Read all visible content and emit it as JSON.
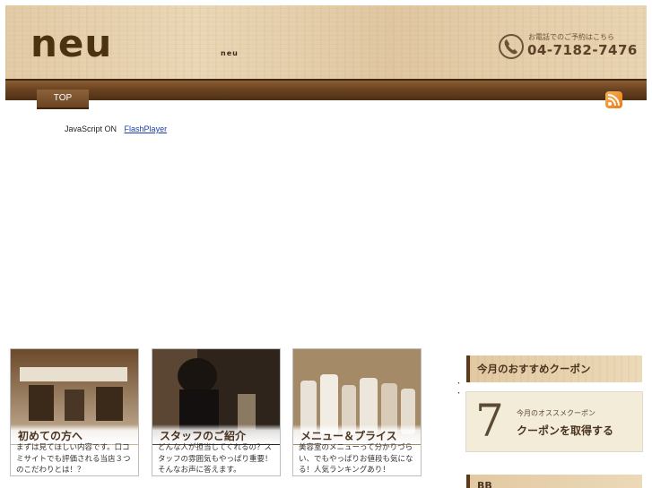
{
  "header": {
    "logo": "neu",
    "site_sub": "neu",
    "phone_note": "お電話でのご予約はこちら",
    "phone_number": "04-7182-7476",
    "phone_icon": "phone-icon"
  },
  "nav": {
    "top_label": "TOP",
    "rss_icon": "rss-icon"
  },
  "flash": {
    "notice": "JavaScript ON",
    "link": "FlashPlayer"
  },
  "cards": [
    {
      "title": "初めての方へ",
      "text": "まずは見てほしい内容です。口コミサイトでも評価される当店３つのこだわりとは！？"
    },
    {
      "title": "スタッフのご紹介",
      "text": "どんな人が担当してくれるの？スタッフの雰囲気もやっぱり重要！そんなお声に答えます。"
    },
    {
      "title": "メニュー＆プライス",
      "text": "美容室のメニューって分かりづらい、でもやっぱりお値段も気になる！人気ランキングあり！"
    }
  ],
  "bullets": [
    "・",
    "・"
  ],
  "sidebar": {
    "coupon_heading": "今月のおすすめクーポン",
    "coupon_number": "7",
    "coupon_note": "今月のオススメクーポン",
    "coupon_cta": "クーポンを取得する",
    "next_heading": "BB"
  },
  "colors": {
    "brand_brown": "#4d3212",
    "nav_brown": "#6a4321",
    "link_blue": "#1a3fa6"
  }
}
